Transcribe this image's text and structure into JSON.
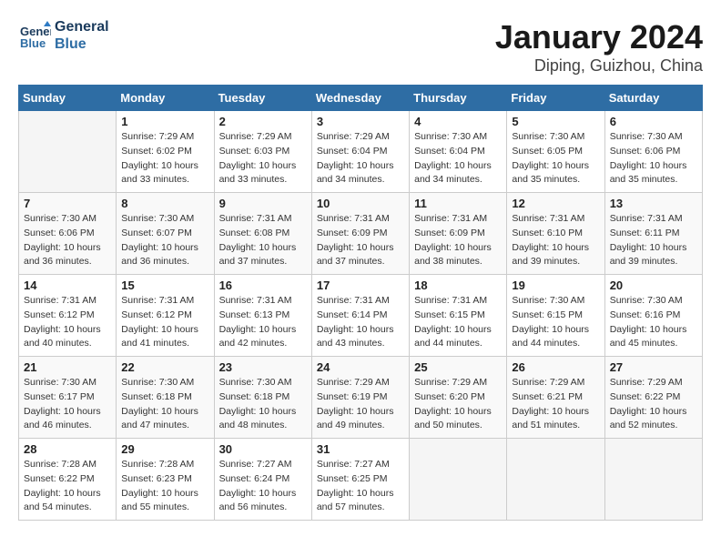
{
  "header": {
    "logo_line1": "General",
    "logo_line2": "Blue",
    "month": "January 2024",
    "location": "Diping, Guizhou, China"
  },
  "weekdays": [
    "Sunday",
    "Monday",
    "Tuesday",
    "Wednesday",
    "Thursday",
    "Friday",
    "Saturday"
  ],
  "weeks": [
    [
      {
        "day": "",
        "info": ""
      },
      {
        "day": "1",
        "info": "Sunrise: 7:29 AM\nSunset: 6:02 PM\nDaylight: 10 hours\nand 33 minutes."
      },
      {
        "day": "2",
        "info": "Sunrise: 7:29 AM\nSunset: 6:03 PM\nDaylight: 10 hours\nand 33 minutes."
      },
      {
        "day": "3",
        "info": "Sunrise: 7:29 AM\nSunset: 6:04 PM\nDaylight: 10 hours\nand 34 minutes."
      },
      {
        "day": "4",
        "info": "Sunrise: 7:30 AM\nSunset: 6:04 PM\nDaylight: 10 hours\nand 34 minutes."
      },
      {
        "day": "5",
        "info": "Sunrise: 7:30 AM\nSunset: 6:05 PM\nDaylight: 10 hours\nand 35 minutes."
      },
      {
        "day": "6",
        "info": "Sunrise: 7:30 AM\nSunset: 6:06 PM\nDaylight: 10 hours\nand 35 minutes."
      }
    ],
    [
      {
        "day": "7",
        "info": "Sunrise: 7:30 AM\nSunset: 6:06 PM\nDaylight: 10 hours\nand 36 minutes."
      },
      {
        "day": "8",
        "info": "Sunrise: 7:30 AM\nSunset: 6:07 PM\nDaylight: 10 hours\nand 36 minutes."
      },
      {
        "day": "9",
        "info": "Sunrise: 7:31 AM\nSunset: 6:08 PM\nDaylight: 10 hours\nand 37 minutes."
      },
      {
        "day": "10",
        "info": "Sunrise: 7:31 AM\nSunset: 6:09 PM\nDaylight: 10 hours\nand 37 minutes."
      },
      {
        "day": "11",
        "info": "Sunrise: 7:31 AM\nSunset: 6:09 PM\nDaylight: 10 hours\nand 38 minutes."
      },
      {
        "day": "12",
        "info": "Sunrise: 7:31 AM\nSunset: 6:10 PM\nDaylight: 10 hours\nand 39 minutes."
      },
      {
        "day": "13",
        "info": "Sunrise: 7:31 AM\nSunset: 6:11 PM\nDaylight: 10 hours\nand 39 minutes."
      }
    ],
    [
      {
        "day": "14",
        "info": "Sunrise: 7:31 AM\nSunset: 6:12 PM\nDaylight: 10 hours\nand 40 minutes."
      },
      {
        "day": "15",
        "info": "Sunrise: 7:31 AM\nSunset: 6:12 PM\nDaylight: 10 hours\nand 41 minutes."
      },
      {
        "day": "16",
        "info": "Sunrise: 7:31 AM\nSunset: 6:13 PM\nDaylight: 10 hours\nand 42 minutes."
      },
      {
        "day": "17",
        "info": "Sunrise: 7:31 AM\nSunset: 6:14 PM\nDaylight: 10 hours\nand 43 minutes."
      },
      {
        "day": "18",
        "info": "Sunrise: 7:31 AM\nSunset: 6:15 PM\nDaylight: 10 hours\nand 44 minutes."
      },
      {
        "day": "19",
        "info": "Sunrise: 7:30 AM\nSunset: 6:15 PM\nDaylight: 10 hours\nand 44 minutes."
      },
      {
        "day": "20",
        "info": "Sunrise: 7:30 AM\nSunset: 6:16 PM\nDaylight: 10 hours\nand 45 minutes."
      }
    ],
    [
      {
        "day": "21",
        "info": "Sunrise: 7:30 AM\nSunset: 6:17 PM\nDaylight: 10 hours\nand 46 minutes."
      },
      {
        "day": "22",
        "info": "Sunrise: 7:30 AM\nSunset: 6:18 PM\nDaylight: 10 hours\nand 47 minutes."
      },
      {
        "day": "23",
        "info": "Sunrise: 7:30 AM\nSunset: 6:18 PM\nDaylight: 10 hours\nand 48 minutes."
      },
      {
        "day": "24",
        "info": "Sunrise: 7:29 AM\nSunset: 6:19 PM\nDaylight: 10 hours\nand 49 minutes."
      },
      {
        "day": "25",
        "info": "Sunrise: 7:29 AM\nSunset: 6:20 PM\nDaylight: 10 hours\nand 50 minutes."
      },
      {
        "day": "26",
        "info": "Sunrise: 7:29 AM\nSunset: 6:21 PM\nDaylight: 10 hours\nand 51 minutes."
      },
      {
        "day": "27",
        "info": "Sunrise: 7:29 AM\nSunset: 6:22 PM\nDaylight: 10 hours\nand 52 minutes."
      }
    ],
    [
      {
        "day": "28",
        "info": "Sunrise: 7:28 AM\nSunset: 6:22 PM\nDaylight: 10 hours\nand 54 minutes."
      },
      {
        "day": "29",
        "info": "Sunrise: 7:28 AM\nSunset: 6:23 PM\nDaylight: 10 hours\nand 55 minutes."
      },
      {
        "day": "30",
        "info": "Sunrise: 7:27 AM\nSunset: 6:24 PM\nDaylight: 10 hours\nand 56 minutes."
      },
      {
        "day": "31",
        "info": "Sunrise: 7:27 AM\nSunset: 6:25 PM\nDaylight: 10 hours\nand 57 minutes."
      },
      {
        "day": "",
        "info": ""
      },
      {
        "day": "",
        "info": ""
      },
      {
        "day": "",
        "info": ""
      }
    ]
  ]
}
